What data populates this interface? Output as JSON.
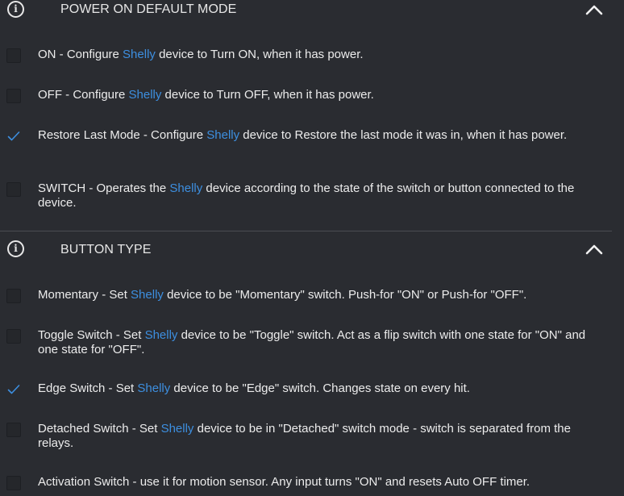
{
  "sections": [
    {
      "icon": "info-icon",
      "title": "POWER ON DEFAULT MODE",
      "options": [
        {
          "checked": false,
          "pre": "ON - Configure ",
          "brand": "Shelly",
          "post": " device to Turn ON, when it has power."
        },
        {
          "checked": false,
          "pre": "OFF - Configure ",
          "brand": "Shelly",
          "post": " device to Turn OFF, when it has power."
        },
        {
          "checked": true,
          "pre": "Restore Last Mode - Configure ",
          "brand": "Shelly",
          "post": " device to Restore the last mode it was in, when it has power."
        },
        {
          "checked": false,
          "pre": "SWITCH - Operates the ",
          "brand": "Shelly",
          "post": " device according to the state of the switch or button connected to the device."
        }
      ]
    },
    {
      "icon": "info-icon",
      "title": "BUTTON TYPE",
      "options": [
        {
          "checked": false,
          "pre": "Momentary - Set ",
          "brand": "Shelly",
          "post": " device to be \"Momentary\" switch. Push-for \"ON\" or Push-for \"OFF\"."
        },
        {
          "checked": false,
          "pre": "Toggle Switch - Set ",
          "brand": "Shelly",
          "post": " device to be \"Toggle\" switch. Act as a flip switch with one state for \"ON\" and one state for \"OFF\"."
        },
        {
          "checked": true,
          "pre": "Edge Switch - Set ",
          "brand": "Shelly",
          "post": " device to be \"Edge\" switch. Changes state on every hit."
        },
        {
          "checked": false,
          "pre": "Detached Switch - Set ",
          "brand": "Shelly",
          "post": " device to be in \"Detached\" switch mode - switch is separated from the relays."
        },
        {
          "checked": false,
          "pre": "Activation Switch - use it for motion sensor. Any input turns \"ON\" and resets Auto OFF timer.",
          "brand": "",
          "post": ""
        }
      ]
    }
  ],
  "colors": {
    "background": "#2a2c31",
    "brand": "#3d8fe0",
    "check": "#3d8fe0",
    "text": "#ececec"
  }
}
